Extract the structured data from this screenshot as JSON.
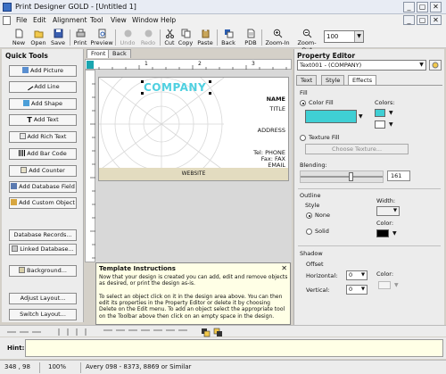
{
  "window": {
    "title": "Print Designer GOLD - [Untitled 1]",
    "minimize": "_",
    "restore": "▢",
    "close": "✕"
  },
  "menu": [
    "File",
    "Edit",
    "Alignment",
    "Tool",
    "View",
    "Window",
    "Help"
  ],
  "toolbar": {
    "new": "New",
    "open": "Open",
    "save": "Save",
    "print": "Print",
    "preview": "Preview",
    "undo": "Undo",
    "redo": "Redo",
    "cut": "Cut",
    "copy": "Copy",
    "paste": "Paste",
    "back": "Back",
    "pdb": "PDB",
    "zoom_in": "Zoom-In",
    "zoom_out": "Zoom-Out",
    "zoom_value": "100"
  },
  "quick_tools": {
    "title": "Quick Tools",
    "buttons": [
      "Add Picture",
      "Add Line",
      "Add Shape",
      "Add Text",
      "Add Rich Text",
      "Add Bar Code",
      "Add Counter",
      "Add Database Field",
      "Add Custom Object"
    ],
    "bottom_buttons": [
      "Database Records...",
      "Linked Database...",
      "Background...",
      "Adjust Layout...",
      "Switch Layout..."
    ]
  },
  "canvas": {
    "tabs": [
      "Front",
      "Back"
    ],
    "ruler_numbers": [
      "1",
      "2",
      "3"
    ],
    "card": {
      "company": "COMPANY",
      "name": "NAME",
      "title": "TITLE",
      "address": "ADDRESS",
      "tel": "Tel: PHONE",
      "fax": "Fax: FAX",
      "email": "EMAIL",
      "website": "WEBSITE"
    }
  },
  "instructions": {
    "title": "Template Instructions",
    "close": "✕",
    "para1": "Now that your design is created you can add, edit and remove objects as desired, or print the design as-is.",
    "para2": "To select an object click on it in the design area above. You can then edit its properties in the Property Editor or delete it by choosing Delete on the Edit menu. To add an object select the appropriate tool on the Toolbar above then click on an empty space in the design."
  },
  "property_editor": {
    "title": "Property Editor",
    "object": "Text001 - (COMPANY)",
    "tabs": [
      "Text",
      "Style",
      "Effects"
    ],
    "fill_label": "Fill",
    "color_fill": "Color Fill",
    "colors_label": "Colors:",
    "texture_fill": "Texture Fill",
    "choose_texture": "Choose Texture...",
    "blending_label": "Blending:",
    "blending_value": "161",
    "outline_label": "Outline",
    "style_label": "Style",
    "width_label": "Width:",
    "none_label": "None",
    "solid_label": "Solid",
    "color_label": "Color:",
    "shadow_label": "Shadow",
    "offset_label": "Offset",
    "horizontal_label": "Horizontal:",
    "horizontal_value": "0",
    "vertical_label": "Vertical:",
    "vertical_value": "0",
    "shadow_color_label": "Color:",
    "fill_color": "#3fcfd4",
    "secondary_color": "#3fcfd4",
    "outline_color": "#000000"
  },
  "hint": {
    "label": "Hint:"
  },
  "status": {
    "coords": "348 , 98",
    "zoom": "100%",
    "template": "Avery 098 - 8373, 8869 or Similar"
  }
}
